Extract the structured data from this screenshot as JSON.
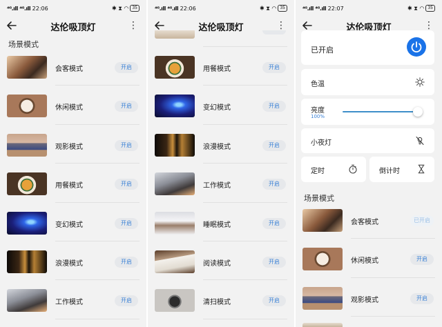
{
  "status_bars": [
    {
      "signal": "⁴ᴳ.ıll ⁴ᴳ.ıll",
      "time": "22:06",
      "right": "✱ ⧗ ◠",
      "battery": "35"
    },
    {
      "signal": "⁴ᴳ.ıll ⁴ᴳ.ıll",
      "time": "22:06",
      "right": "✱ ⧗ ◠",
      "battery": "35"
    },
    {
      "signal": "⁴ᴳ.ıll ⁴ᴳ.ıll",
      "time": "22:07",
      "right": "✱ ⧗ ◠",
      "battery": "35"
    }
  ],
  "header": {
    "title": "达伦吸顶灯",
    "more": "⋮"
  },
  "section_title": "场景模式",
  "button_on": "开启",
  "button_active": "已开启",
  "screen1": {
    "scenes": [
      {
        "label": "会客模式",
        "thumb": "t-meeting"
      },
      {
        "label": "休闲模式",
        "thumb": "t-leisure"
      },
      {
        "label": "观影模式",
        "thumb": "t-movie"
      },
      {
        "label": "用餐模式",
        "thumb": "t-dining"
      },
      {
        "label": "变幻模式",
        "thumb": "t-magic"
      },
      {
        "label": "浪漫模式",
        "thumb": "t-romance"
      },
      {
        "label": "工作模式",
        "thumb": "t-work"
      }
    ]
  },
  "screen2": {
    "scenes": [
      {
        "label": "用餐模式",
        "thumb": "t-dining"
      },
      {
        "label": "变幻模式",
        "thumb": "t-magic"
      },
      {
        "label": "浪漫模式",
        "thumb": "t-romance"
      },
      {
        "label": "工作模式",
        "thumb": "t-work"
      },
      {
        "label": "睡眠模式",
        "thumb": "t-sleep"
      },
      {
        "label": "阅读模式",
        "thumb": "t-read"
      },
      {
        "label": "清扫模式",
        "thumb": "t-clean"
      }
    ]
  },
  "screen3": {
    "power": {
      "label": "已开启",
      "on": true
    },
    "color_temp": {
      "label": "色温"
    },
    "brightness": {
      "label": "亮度",
      "value": "100%",
      "level": 1.0
    },
    "night_light": {
      "label": "小夜灯"
    },
    "timer": {
      "label": "定时"
    },
    "countdown": {
      "label": "倒计时"
    },
    "scenes": [
      {
        "label": "会客模式",
        "thumb": "t-meeting",
        "active": true
      },
      {
        "label": "休闲模式",
        "thumb": "t-leisure",
        "active": false
      },
      {
        "label": "观影模式",
        "thumb": "t-movie",
        "active": false
      }
    ]
  },
  "colors": {
    "accent": "#1a73e8",
    "button_text": "#3b82d6",
    "background": "#f2f2f2"
  }
}
